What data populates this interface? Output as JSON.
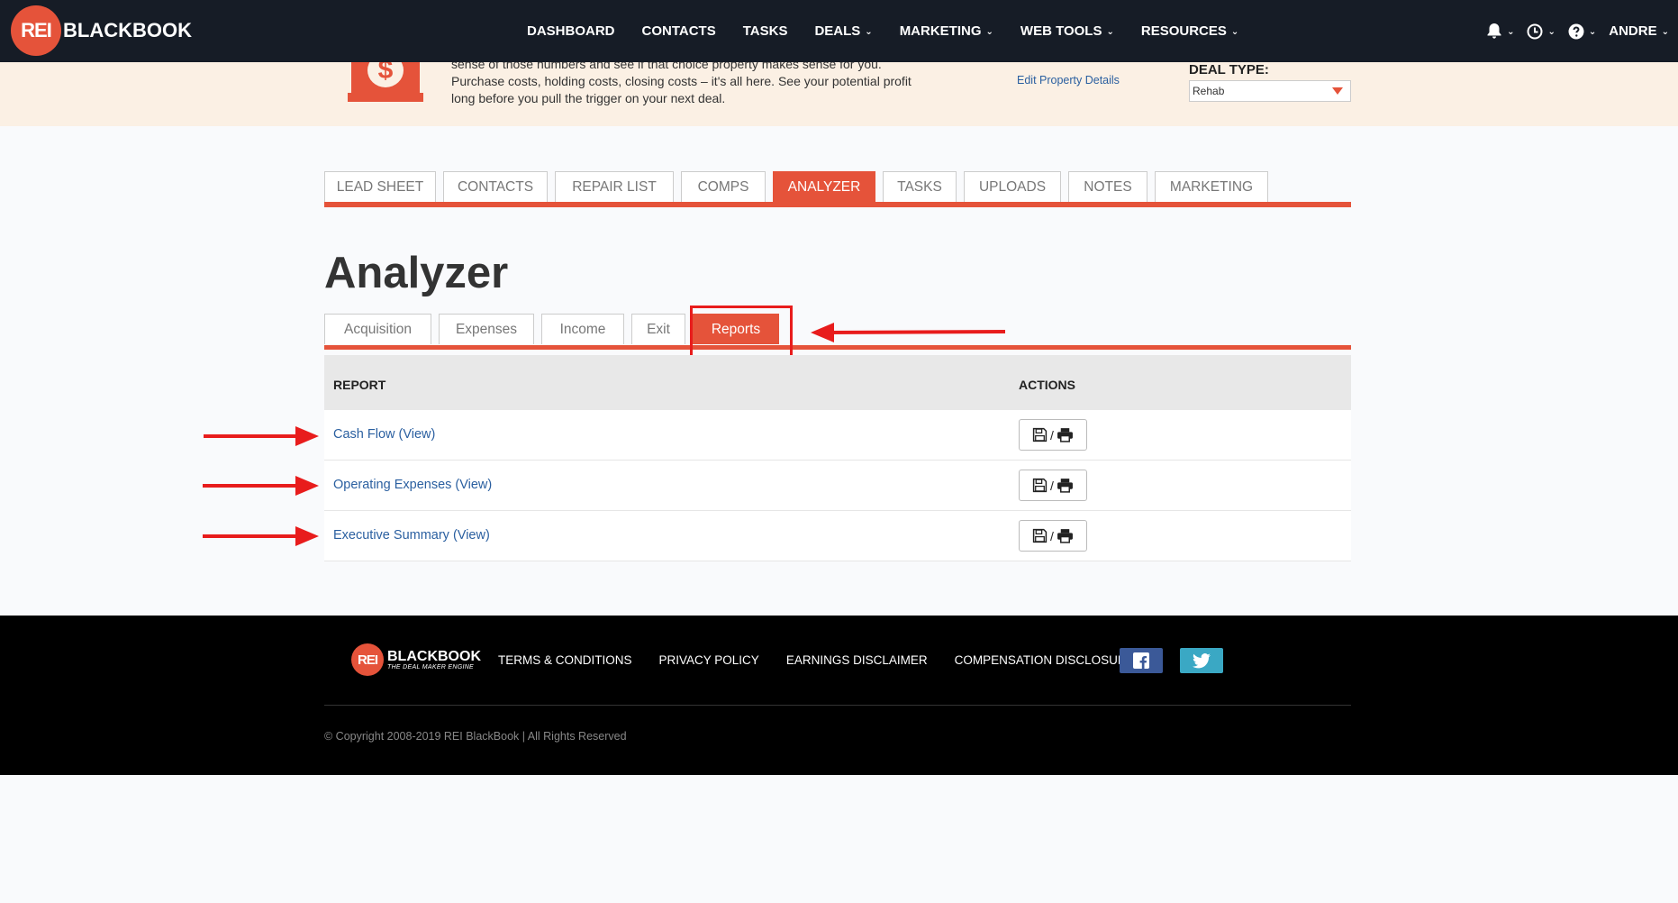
{
  "brand": {
    "logo_badge": "REI",
    "logo_text": "BLACKBOOK"
  },
  "nav": {
    "items": [
      {
        "label": "DASHBOARD",
        "dropdown": false
      },
      {
        "label": "CONTACTS",
        "dropdown": false
      },
      {
        "label": "TASKS",
        "dropdown": false
      },
      {
        "label": "DEALS",
        "dropdown": true
      },
      {
        "label": "MARKETING",
        "dropdown": true
      },
      {
        "label": "WEB TOOLS",
        "dropdown": true
      },
      {
        "label": "RESOURCES",
        "dropdown": true
      }
    ],
    "user": "ANDRE"
  },
  "banner": {
    "line1": "sense of those numbers and see if that choice property makes sense for you.",
    "line2": "Purchase costs, holding costs, closing costs – it's all here. See your potential profit",
    "line3": "long before you pull the trigger on your next deal.",
    "edit_link": "Edit Property Details",
    "deal_type_label": "DEAL TYPE:",
    "deal_type_value": "Rehab"
  },
  "main_tabs": [
    "LEAD SHEET",
    "CONTACTS",
    "REPAIR LIST",
    "COMPS",
    "ANALYZER",
    "TASKS",
    "UPLOADS",
    "NOTES",
    "MARKETING"
  ],
  "page_title": "Analyzer",
  "sub_tabs": [
    "Acquisition",
    "Expenses",
    "Income",
    "Exit",
    "Reports"
  ],
  "table": {
    "col_report": "REPORT",
    "col_actions": "ACTIONS",
    "rows": [
      {
        "label": "Cash Flow (View)"
      },
      {
        "label": "Operating Expenses (View)"
      },
      {
        "label": "Executive Summary (View)"
      }
    ],
    "action_separator": "/"
  },
  "footer": {
    "logo_badge": "REI",
    "logo_text": "BLACKBOOK",
    "tagline": "THE DEAL MAKER ENGINE",
    "links": [
      "TERMS & CONDITIONS",
      "PRIVACY POLICY",
      "EARNINGS DISCLAIMER",
      "COMPENSATION DISCLOSURE"
    ],
    "copyright": "© Copyright 2008-2019 REI BlackBook | All Rights Reserved"
  },
  "colors": {
    "accent": "#e5533a",
    "nav_bg": "#161c26",
    "link": "#2a5fa0",
    "annotation": "#e81c1c"
  }
}
